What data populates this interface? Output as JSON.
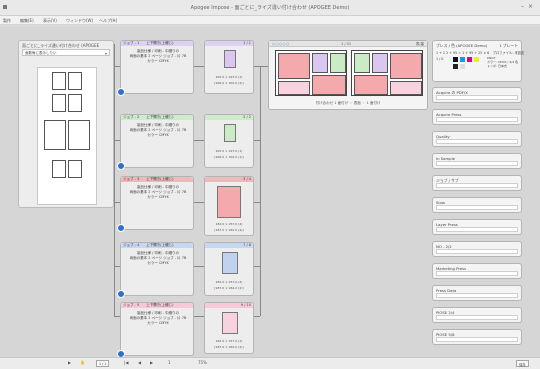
{
  "window": {
    "title": "Apogee Impose - 面ごとに_ライズ違い付け合わせ (APOGEE Demo)",
    "min_glyph": "–",
    "close_glyph": "×"
  },
  "menu": [
    "製作",
    "編集(E)",
    "表示(V)",
    "ウィンドウ(W)",
    "ヘルプ(H)"
  ],
  "navigator": {
    "title": "面ごとに_ライズ違い付け合わせ (APOGEE Demo)",
    "filter": "面数毎に表示したい",
    "chevron": "▾",
    "cell_colors": [
      "#d9c7ef",
      "#d9c7ef",
      "#c9ecc5",
      "#c9ecc5",
      "#f4a9ad",
      "#f4a9ad",
      "#bfd3ef",
      "#f9d2df"
    ]
  },
  "jobs": [
    {
      "header": "ジョブ - 1　　上下開き(上綴じ)",
      "color": "#ddd0f2",
      "lines": [
        "製品仕様 / 印刷 - 中綴りの",
        "両面の基本 2 ページ ジョブ - 片 7B",
        "カラー CMYK"
      ],
      "sheet_header": "1 / 1",
      "sheet_color": "#ddd0f2",
      "page_color": "#d9c7ef",
      "dims": [
        "205.0 × 297.0 (2)",
        "[206.0 × 302.0 (2)]"
      ]
    },
    {
      "header": "ジョブ - 2　　上下開き(上綴じ)",
      "color": "#cdeccc",
      "lines": [
        "製品仕様 / 印刷 - 中綴りの",
        "両面の基本 2 ページ ジョブ - 片 7B",
        "カラー CMYK"
      ],
      "sheet_header": "2 / 2",
      "sheet_color": "#cdeccc",
      "page_color": "#c9ecc5",
      "dims": [
        "205.0 × 297.0 (1)",
        "[206.0 × 302.0 (1)]"
      ]
    },
    {
      "header": "ジョブ - 3　　上下開き(上綴じ)",
      "color": "#f4b5bb",
      "lines": [
        "製品仕様 / 印刷 - 中綴りの",
        "両面の基本 2 ページ ジョブ - 片 7B",
        "カラー CMYK"
      ],
      "sheet_header": "3 / 4",
      "sheet_color": "#f4b5bb",
      "page_color": "#f4a9ad",
      "dims": [
        "182.0 × 257.0 (4)",
        "[187.0 × 262.0 (4)]"
      ]
    },
    {
      "header": "ジョブ - 4　　上下開き(上綴じ)",
      "color": "#c6d8f1",
      "lines": [
        "製品仕様 / 印刷 - 中綴りの",
        "両面の基本 2 ページ ジョブ - 片 7B",
        "カラー CMYK"
      ],
      "sheet_header": "7 / 8",
      "sheet_color": "#c6d8f1",
      "page_color": "#bfd3ef",
      "dims": [
        "182.0 × 257.0 (2)",
        "[187.0 × 262.0 (2)]"
      ]
    },
    {
      "header": "ジョブ - 5　　上下開き(上綴じ)",
      "color": "#f7c9d8",
      "lines": [
        "製品仕様 / 印刷 - 中綴りの",
        "両面の基本 2 ページ ジョブ - 片 7B",
        "カラー CMYK"
      ],
      "sheet_header": "9 / 10",
      "sheet_color": "#f7c9d8",
      "page_color": "#f9d2df",
      "dims": [
        "182.0 × 257.0 (2)",
        "[187.0 × 262.0 (2)]"
      ]
    }
  ],
  "layout": {
    "dots": "○○○○○",
    "zoom": "1 / 01",
    "mode": "表/裏",
    "page_label": "シート 1",
    "footer": "付け合わせ 1 面付け ・ 表面 ・ 1 面付け",
    "colors": [
      "#f4a9ad",
      "#d9c7ef",
      "#c9ecc5",
      "#f4a9ad"
    ]
  },
  "sidebar": {
    "title": "プレス / 色 (APOGEE Demo)",
    "title_right": "1 プレート",
    "line": "1 + 2 2 + 95 = 1 + 95 + 25 × 6　プロファイル: 未設定",
    "row_label": "1 / 0",
    "swatch_colors": [
      "#111111",
      "#00a4e4",
      "#e6007e",
      "#ffed00",
      "#222222",
      "#dddddd"
    ],
    "note_lines": [
      "KNOT",
      "カラー: CMYK / 4/4 色",
      "トンボ: 日本式"
    ],
    "boxes": [
      "Acquire の PDF/X",
      "Acquire Press",
      "Quality",
      "In Sample",
      "ジョブ / サブ",
      "Slow",
      "Layer Press",
      "NO - 2/2",
      "Marketing Press",
      "Press Data",
      "PIOSE 2/4",
      "PIOSE 5/8"
    ]
  },
  "statusbar": {
    "pointer": "▶",
    "hand": "✋",
    "page_field": "1 / 1",
    "nav_first": "|◀",
    "nav_prev": "◀",
    "nav_next": "▶",
    "num": "1",
    "zoom_text": "75%",
    "right_btn": "保存"
  }
}
